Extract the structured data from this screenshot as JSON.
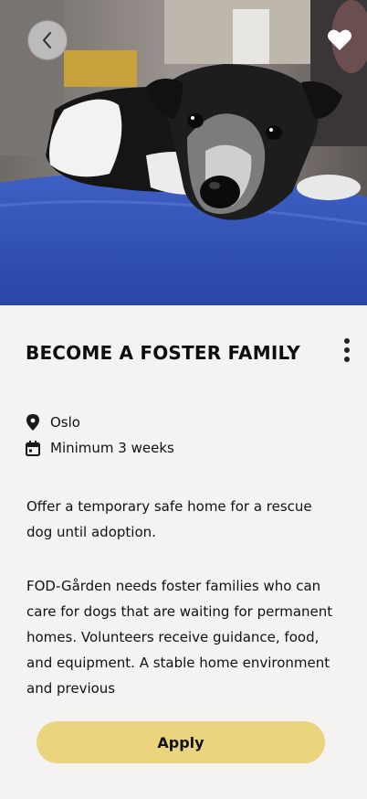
{
  "hero": {
    "image_alt": "Black and white dog lying on a blue cushion",
    "back_icon": "chevron-left-icon",
    "favorite_icon": "heart-icon"
  },
  "listing": {
    "title": "BECOME A FOSTER FAMILY",
    "more_icon": "vertical-dots-icon",
    "location_icon": "map-pin-icon",
    "location": "Oslo",
    "duration_icon": "calendar-icon",
    "duration": "Minimum 3 weeks",
    "intro": "Offer a temporary safe home for a rescue dog until adoption.",
    "body": "FOD-Gården needs foster families who can care for dogs that are waiting for permanent homes. Volunteers receive guidance, food, and equipment. A stable home environment and previous"
  },
  "actions": {
    "apply_label": "Apply"
  },
  "colors": {
    "background": "#f4f3f1",
    "apply_button": "#ebd47e",
    "text": "#111111"
  }
}
